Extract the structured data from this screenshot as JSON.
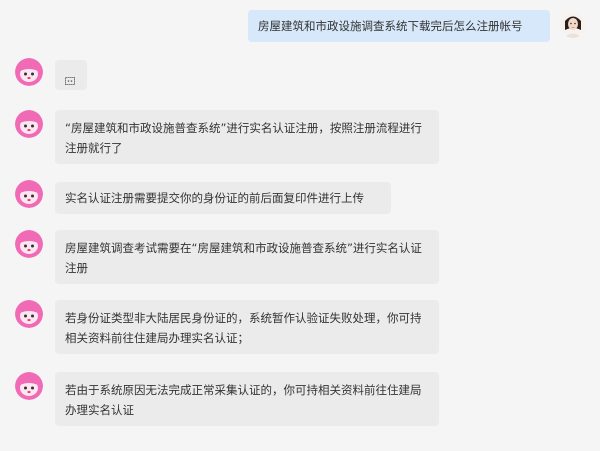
{
  "colors": {
    "background": "#f5f5f5",
    "bot_bubble": "#ebebeb",
    "user_bubble": "#d7e8fa",
    "mascot_pink": "#f06ab5"
  },
  "icons": {
    "bot_avatar": "cartoon-mascot-avatar",
    "user_avatar": "user-portrait-avatar",
    "placeholder": "emoji-placeholder"
  },
  "conversation": {
    "user_question": "房屋建筑和市政设施调查系统下载完后怎么注册帐号",
    "bot_messages": [
      {
        "text": "“房屋建筑和市政设施普查系统”进行实名认证注册，按照注册流程进行注册就行了"
      },
      {
        "text": "实名认证注册需要提交你的身份证的前后面复印件进行上传"
      },
      {
        "text": "房屋建筑调查考试需要在“房屋建筑和市政设施普查系统”进行实名认证注册"
      },
      {
        "text": "若身份证类型非大陆居民身份证的，系统暂作认验证失败处理，你可持相关资料前往住建局办理实名认证；"
      },
      {
        "text": "若由于系统原因无法完成正常采集认证的，你可持相关资料前往住建局办理实名认证"
      }
    ]
  }
}
